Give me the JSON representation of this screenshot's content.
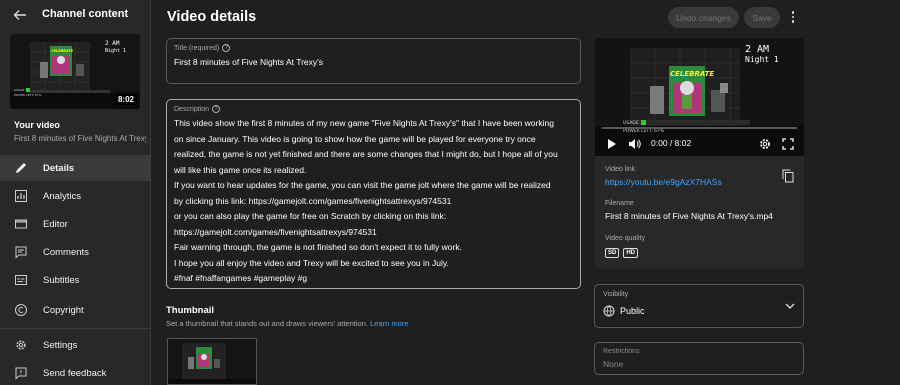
{
  "sidebar": {
    "title": "Channel content",
    "duration": "8:02",
    "your_video": "Your video",
    "video_title": "First 8 minutes of Five Nights At Trexy's",
    "items": [
      {
        "label": "Details",
        "icon": "pencil-icon",
        "active": true
      },
      {
        "label": "Analytics",
        "icon": "analytics-icon"
      },
      {
        "label": "Editor",
        "icon": "editor-icon"
      },
      {
        "label": "Comments",
        "icon": "comments-icon"
      },
      {
        "label": "Subtitles",
        "icon": "subtitles-icon"
      },
      {
        "label": "Copyright",
        "icon": "copyright-icon"
      },
      {
        "label": "Settings",
        "icon": "gear-icon"
      },
      {
        "label": "Send feedback",
        "icon": "feedback-icon"
      }
    ]
  },
  "header": {
    "title": "Video details",
    "undo_label": "Undo changes",
    "save_label": "Save"
  },
  "title_field": {
    "label": "Title (required)",
    "value": "First 8 minutes of Five Nights At Trexy's"
  },
  "description_field": {
    "label": "Description",
    "lines": [
      "This video show the first 8 minutes of my new game \"Five Nights At Trexy's\" that I have been working",
      "on since January. This video is going to show how the game will be played for everyone try once",
      "realized, the game is not yet finished and there are some changes that I might do, but I hope all of you",
      "will like this game once its realized.",
      "If you want to hear updates for the game, you can visit the game jolt where the game will be realized",
      "by clicking this link:  https://gamejolt.com/games/fivenightsattrexys/974531",
      "or you can also play the game for free on Scratch by clicking on this link:",
      "https://gamejolt.com/games/fivenightsattrexys/974531",
      "Fair warning through, the game is not finished so don't expect it to fully work.",
      "I hope you all enjoy the video and Trexy will be excited to see you in July.",
      "#fnaf #fnaffangames #gameplay #g"
    ]
  },
  "thumbnail": {
    "heading": "Thumbnail",
    "subtext": "Set a thumbnail that stands out and draws viewers' attention.",
    "learn_more": "Learn more"
  },
  "game_art": {
    "clock_time": "2 AM",
    "night": "Night 1",
    "poster_text": "CELEBRATE",
    "usage_label": "USAGE",
    "power_label": "POWER LEFT: 67%"
  },
  "player": {
    "time": "0:00 / 8:02",
    "progress": 0
  },
  "video_info": {
    "link_label": "Video link",
    "link_value": "https://youtu.be/e9gAzX7HASs",
    "filename_label": "Filename",
    "filename_value": "First 8 minutes of Five Nights At Trexy's.mp4",
    "quality_label": "Video quality",
    "qualities": [
      "SD",
      "HD"
    ]
  },
  "visibility": {
    "label": "Visibility",
    "value": "Public"
  },
  "restrictions": {
    "label": "Restrictions",
    "value": "None"
  },
  "colors": {
    "background": "#1f1f1f",
    "sidebar": "#282828",
    "link": "#3ea6ff",
    "poster_green": "#4caf50",
    "poster_pink": "#d63384"
  }
}
